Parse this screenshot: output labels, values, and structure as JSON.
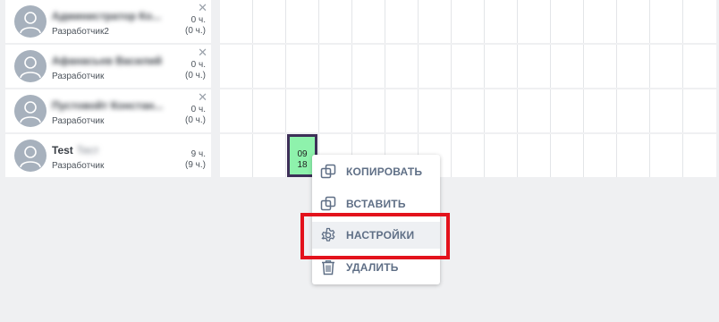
{
  "employees": [
    {
      "name": "Администратор Ко...",
      "role": "Разработчик2",
      "hours": "0 ч.",
      "hours_paren": "(0 ч.)",
      "closable": true
    },
    {
      "name": "Афанасьев Василий",
      "role": "Разработчик",
      "hours": "0 ч.",
      "hours_paren": "(0 ч.)",
      "closable": true
    },
    {
      "name": "Пустовойт Констан...",
      "role": "Разработчик",
      "hours": "0 ч.",
      "hours_paren": "(0 ч.)",
      "closable": true
    },
    {
      "name": "Test",
      "name_tail": "Тест",
      "role": "Разработчик",
      "hours": "9 ч.",
      "hours_paren": "(9 ч.)",
      "closable": false
    }
  ],
  "shift": {
    "start": "09",
    "end": "18",
    "color": "#8ef2ac",
    "border_color": "#3d2f58"
  },
  "context_menu": {
    "items": [
      {
        "label": "КОПИРОВАТЬ",
        "icon": "copy-icon"
      },
      {
        "label": "ВСТАВИТЬ",
        "icon": "paste-icon"
      },
      {
        "label": "НАСТРОЙКИ",
        "icon": "gear-icon"
      },
      {
        "label": "УДАЛИТЬ",
        "icon": "trash-icon"
      }
    ]
  },
  "colors": {
    "highlight": "#e3121c",
    "menu_text": "#5f6f86",
    "background": "#eff0f2"
  }
}
